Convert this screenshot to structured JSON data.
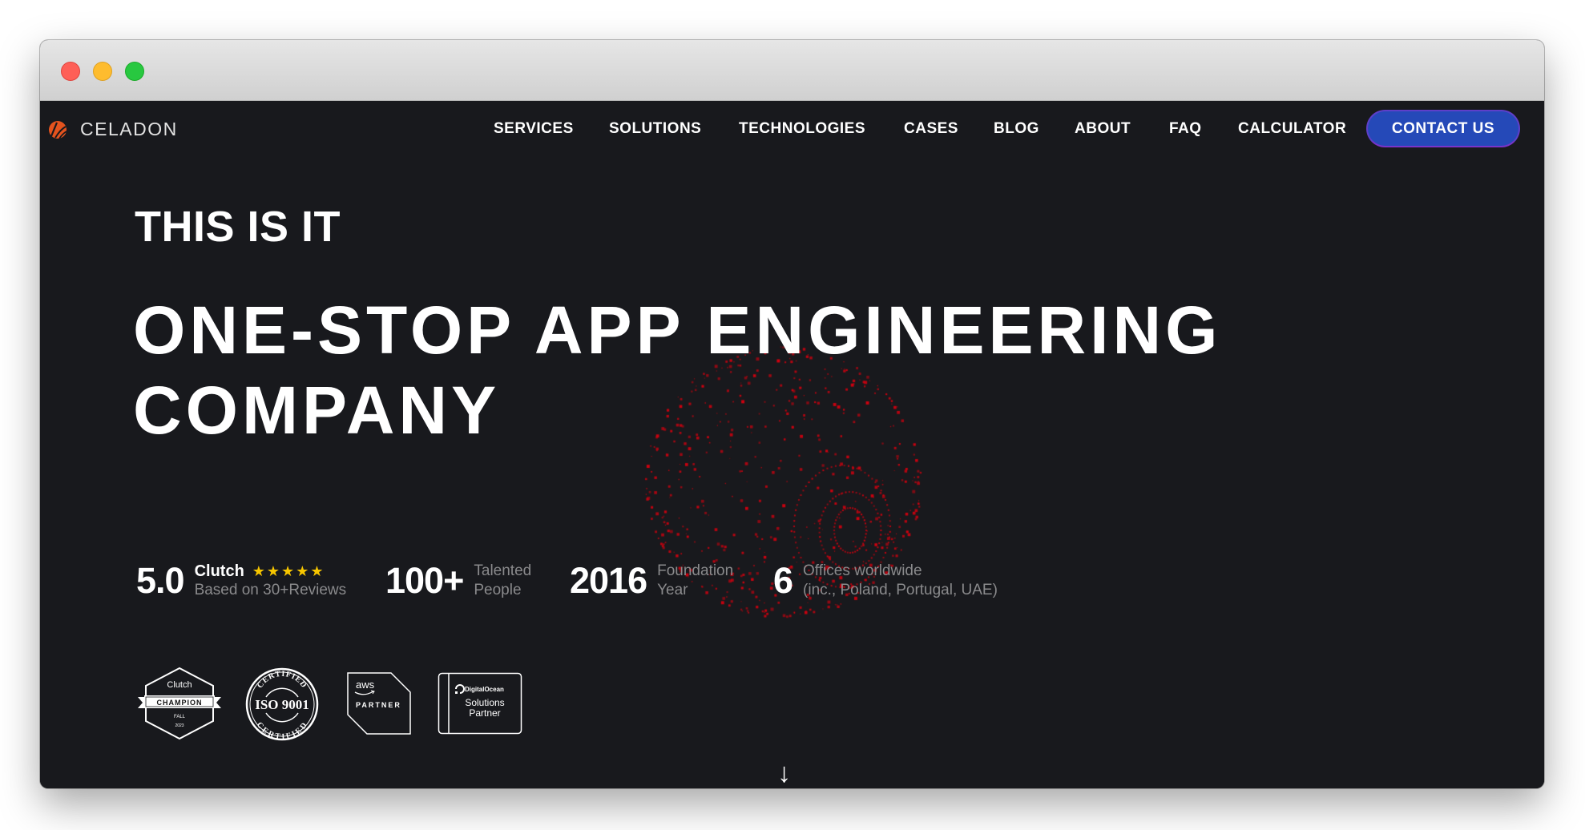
{
  "window": {
    "controls": [
      "close",
      "minimize",
      "maximize"
    ]
  },
  "brand": {
    "name": "CELADON",
    "logo_icon": "celadon-logo-icon",
    "logo_color": "#e4531e"
  },
  "nav": {
    "items": [
      {
        "label": "SERVICES"
      },
      {
        "label": "SOLUTIONS"
      },
      {
        "label": "TECHNOLOGIES"
      },
      {
        "label": "CASES"
      },
      {
        "label": "BLOG"
      },
      {
        "label": "ABOUT"
      },
      {
        "label": "FAQ"
      },
      {
        "label": "CALCULATOR"
      }
    ],
    "cta": {
      "label": "CONTACT US",
      "color": "#2549b8",
      "border_color": "#7a33c9"
    }
  },
  "hero": {
    "eyebrow": "THIS IS IT",
    "headline_line1": "ONE-STOP APP ENGINEERING",
    "headline_line2": "COMPANY",
    "decoration": "red-dot-globe",
    "decoration_color": "#d0000f"
  },
  "stats": [
    {
      "value": "5.0",
      "brand": "Clutch",
      "stars": "★★★★★",
      "rating_stars": 5,
      "caption": "Based on 30+Reviews"
    },
    {
      "value": "100+",
      "line1": "Talented",
      "line2": "People"
    },
    {
      "value": "2016",
      "line1": "Foundation",
      "line2": "Year"
    },
    {
      "value": "6",
      "line1": "Offices worldwide",
      "line2": "(inc., Poland, Portugal, UAE)"
    }
  ],
  "badges": {
    "clutch": {
      "brand": "Clutch",
      "title": "CHAMPION",
      "season": "FALL",
      "year": "2023"
    },
    "iso": {
      "top": "CERTIFIED",
      "title": "ISO 9001",
      "bottom": "CERTIFIED"
    },
    "aws": {
      "brand": "aws",
      "title": "PARTNER"
    },
    "digitalocean": {
      "brand": "DigitalOcean",
      "line1": "Solutions",
      "line2": "Partner"
    }
  },
  "scroll": {
    "icon": "arrow-down-icon",
    "glyph": "↓"
  }
}
